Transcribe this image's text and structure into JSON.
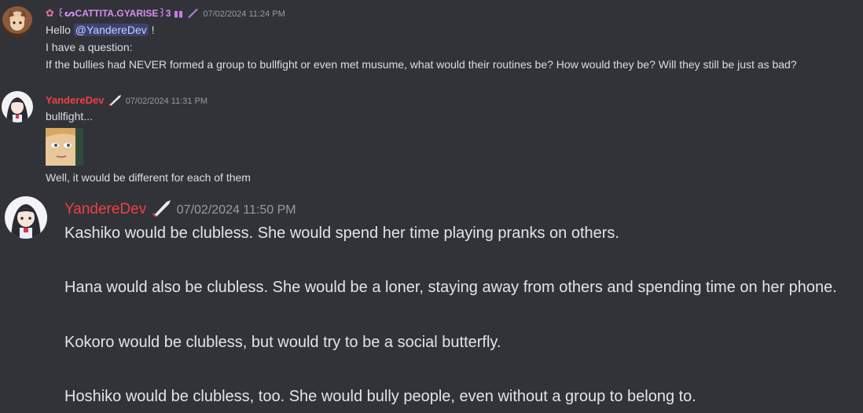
{
  "messages": [
    {
      "author": "꒰ᔕCATTITA.GYARISE꒱3",
      "timestamp": "07/02/2024 11:24 PM",
      "lines": {
        "greeting_prefix": "Hello ",
        "mention": "@YandereDev",
        "greeting_suffix": " !",
        "line2": "I have a question:",
        "line3": "If the bullies had NEVER formed a group to bullfight or even met musume, what would their routines be? How would they be? Will they still be just as bad?"
      },
      "author_color": "#d58ef0"
    },
    {
      "author": "YandereDev",
      "timestamp": "07/02/2024 11:31 PM",
      "lines": {
        "line1": "bullfight...",
        "line2": "Well, it would be different for each of them"
      },
      "author_color": "#f23f43"
    },
    {
      "author": "YandereDev",
      "timestamp": "07/02/2024 11:50 PM",
      "lines": {
        "line1": "Kashiko would be clubless. She would spend her time playing pranks on others.",
        "line2": "Hana would also be clubless. She would be a loner, staying away from others and spending time on her phone.",
        "line3": "Kokoro would be clubless, but would try to be a social butterfly.",
        "line4": "Hoshiko would be clubless, too. She would bully people, even without a group to belong to."
      },
      "author_color": "#f23f43"
    }
  ]
}
